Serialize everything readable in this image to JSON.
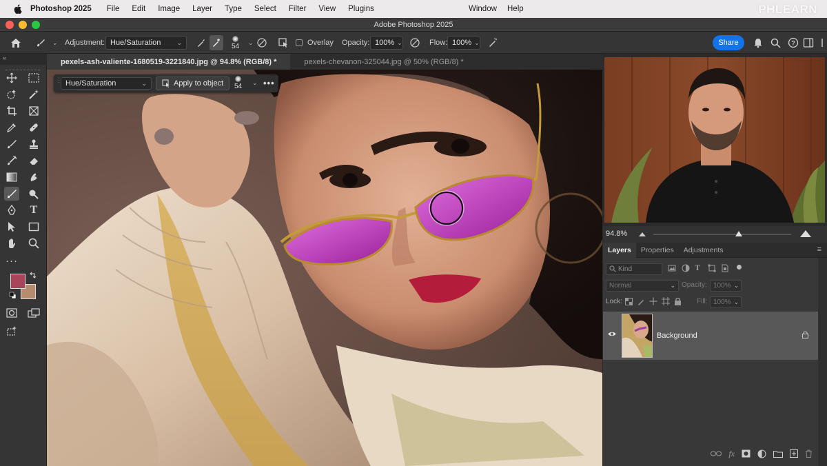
{
  "menubar": {
    "app_name": "Photoshop 2025",
    "items": [
      "File",
      "Edit",
      "Image",
      "Layer",
      "Type",
      "Select",
      "Filter",
      "View",
      "Plugins"
    ],
    "right_items": [
      "Window",
      "Help"
    ],
    "watermark": "PHLEARN"
  },
  "window": {
    "title": "Adobe Photoshop 2025"
  },
  "options_bar": {
    "adjustment_label": "Adjustment:",
    "adjustment_value": "Hue/Saturation",
    "brush_size": "54",
    "overlay_label": "Overlay",
    "opacity_label": "Opacity:",
    "opacity_value": "100%",
    "flow_label": "Flow:",
    "flow_value": "100%",
    "share_label": "Share"
  },
  "tabs": [
    {
      "label": "pexels-ash-valiente-1680519-3221840.jpg @ 94.8% (RGB/8) *",
      "active": true
    },
    {
      "label": "pexels-chevanon-325044.jpg @ 50% (RGB/8) *",
      "active": false
    }
  ],
  "contextual_bar": {
    "dropdown_value": "Hue/Saturation",
    "apply_label": "Apply to object",
    "brush_size": "54"
  },
  "navigator": {
    "zoom": "94.8%",
    "zoom_fraction": 0.62
  },
  "panel_tabs": [
    "Layers",
    "Properties",
    "Adjustments"
  ],
  "layers": {
    "kind_label": "Kind",
    "blend_mode": "Normal",
    "opacity_label": "Opacity:",
    "opacity_value": "100%",
    "lock_label": "Lock:",
    "fill_label": "Fill:",
    "fill_value": "100%",
    "items": [
      {
        "name": "Background",
        "visible": true,
        "locked": true
      }
    ]
  },
  "colors": {
    "foreground": "#a8455a",
    "background": "#b68c6f",
    "accent": "#1473e6"
  }
}
